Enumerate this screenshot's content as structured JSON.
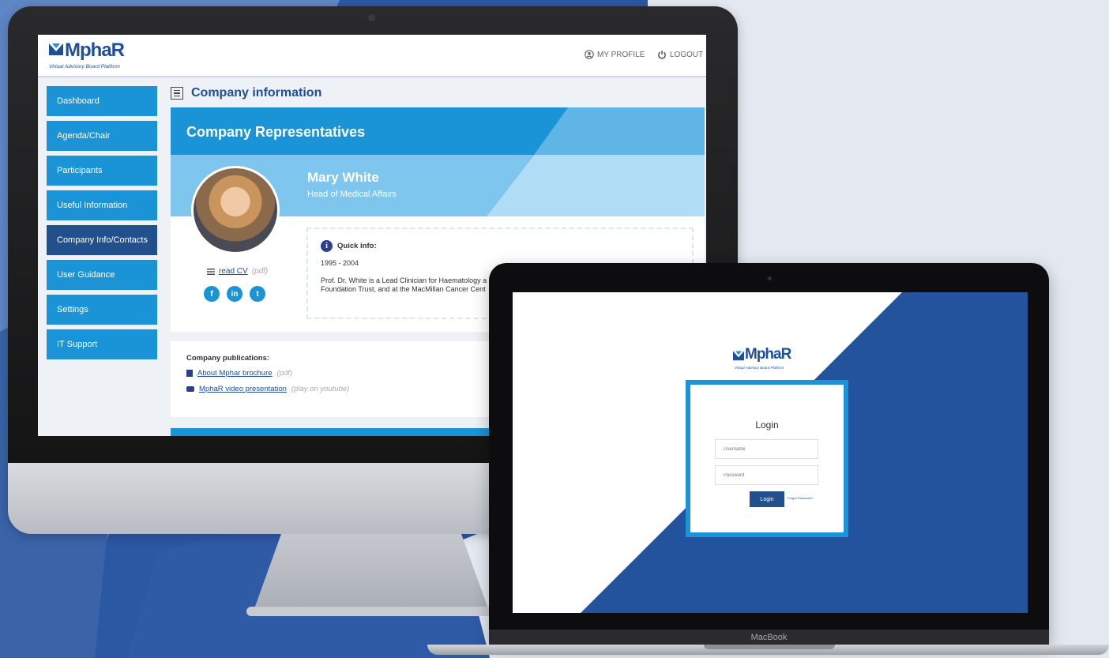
{
  "brand": {
    "logo": "MphaR",
    "tagline": "Virtual Advisory Board Platform"
  },
  "header": {
    "profile_label": "MY PROFILE",
    "logout_label": "LOGOUT"
  },
  "sidebar": {
    "items": [
      {
        "label": "Dashboard"
      },
      {
        "label": "Agenda/Chair"
      },
      {
        "label": "Participants"
      },
      {
        "label": "Useful Information"
      },
      {
        "label": "Company Info/Contacts"
      },
      {
        "label": "User Guidance"
      },
      {
        "label": "Settings"
      },
      {
        "label": "IT Support"
      }
    ],
    "active_index": 4
  },
  "main": {
    "title": "Company information",
    "card_title": "Company Representatives",
    "person": {
      "name": "Mary White",
      "role": "Head of Medical Affairs"
    },
    "cv": {
      "link_label": "read CV",
      "format": "(pdf)"
    },
    "socials": [
      "f",
      "in",
      "t"
    ],
    "quick_info": {
      "heading": "Quick info:",
      "years": "1995 - 2004",
      "text": "Prof. Dr. White is a Lead Clinician for Haematology a Foundation Trust, and at the MacMillan Cancer Cent"
    },
    "publications": {
      "heading": "Company publications:",
      "items": [
        {
          "label": "About Mphar brochure",
          "note": "(pdf)"
        },
        {
          "label": "MphaR video presentation",
          "note": "(play on youtube)"
        }
      ]
    }
  },
  "login": {
    "logo": "MphaR",
    "tagline": "Virtual Advisory Board Platform",
    "title": "Login",
    "username_placeholder": "Username",
    "password_placeholder": "Password",
    "button_label": "Login",
    "forgot_label": "Forgot Password?"
  },
  "device": {
    "laptop_label": "MacBook"
  },
  "colors": {
    "primary_blue": "#1a94d6",
    "dark_blue": "#22508d",
    "background": "#e4e9f1"
  }
}
